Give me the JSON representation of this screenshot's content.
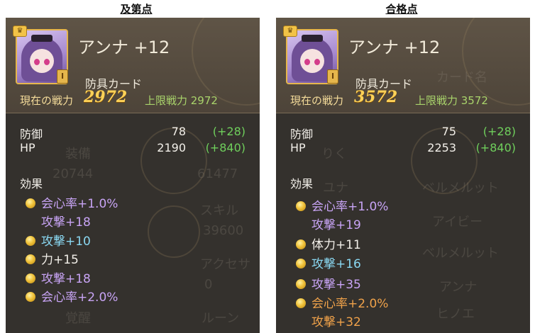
{
  "captions": {
    "left": "及第点",
    "right": "合格点"
  },
  "left": {
    "name": "アンナ +12",
    "type": "防具カード",
    "power_label": "現在の戦力",
    "power_value": "2972",
    "limit": "上限戦力 2972",
    "rank": "I",
    "stats": [
      {
        "label": "防御",
        "value": "78",
        "bonus": "(+28)"
      },
      {
        "label": "HP",
        "value": "2190",
        "bonus": "(+840)"
      }
    ],
    "effects_title": "効果",
    "effects": [
      {
        "text": "会心率+1.0%",
        "color": "purple",
        "dot": true
      },
      {
        "text": "攻撃+18",
        "color": "purple",
        "dot": false
      },
      {
        "text": "攻撃+10",
        "color": "cyan",
        "dot": true
      },
      {
        "text": "力+15",
        "color": "white",
        "dot": true
      },
      {
        "text": "攻撃+18",
        "color": "purple",
        "dot": true
      },
      {
        "text": "会心率+2.0%",
        "color": "purple",
        "dot": true
      }
    ],
    "ghost": [
      "装備",
      "20744",
      "61477",
      "スキル",
      "39600",
      "アクセサ",
      "0",
      "覚醒",
      "ルーン"
    ]
  },
  "right": {
    "name": "アンナ +12",
    "type": "防具カード",
    "power_label": "現在の戦力",
    "power_value": "3572",
    "limit": "上限戦力 3572",
    "rank": "I",
    "stats": [
      {
        "label": "防御",
        "value": "75",
        "bonus": "(+28)"
      },
      {
        "label": "HP",
        "value": "2253",
        "bonus": "(+840)"
      }
    ],
    "effects_title": "効果",
    "effects": [
      {
        "text": "会心率+1.0%",
        "color": "purple",
        "dot": true
      },
      {
        "text": "攻撃+19",
        "color": "purple",
        "dot": false
      },
      {
        "text": "体力+11",
        "color": "white",
        "dot": true
      },
      {
        "text": "攻撃+16",
        "color": "cyan",
        "dot": true
      },
      {
        "text": "攻撃+35",
        "color": "purple",
        "dot": true
      },
      {
        "text": "会心率+2.0%",
        "color": "orange",
        "dot": true
      },
      {
        "text": "攻撃+32",
        "color": "orange",
        "dot": false
      }
    ],
    "ghost": [
      "カード名",
      "りく",
      "ユナ",
      "ベルメルット",
      "アイビー",
      "ベルメルット",
      "アンナ",
      "ヒノエ"
    ]
  }
}
